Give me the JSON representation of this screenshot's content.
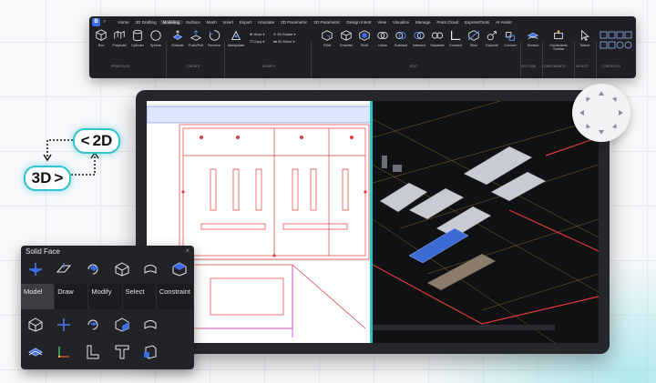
{
  "ribbon": {
    "menu": [
      "Home",
      "2D Drafting",
      "Modeling",
      "Surface",
      "Mesh",
      "Insert",
      "Export",
      "Annotate",
      "2D Parametric",
      "3D Parametric",
      "Design Intent",
      "View",
      "Visualize",
      "Manage",
      "Point Cloud",
      "ExpressTools",
      "AI Assist"
    ],
    "active_menu": "Modeling",
    "tools": {
      "box": "Box",
      "polysolid": "Polysolid",
      "cylinder": "Cylinder",
      "sphere": "Sphere",
      "extrude": "Extrude",
      "pushpull": "Push/Pull",
      "revolve": "Revolve",
      "manipulate": "Manipulate",
      "move": "Move",
      "copy": "Copy",
      "rotate3d": "3D Rotate",
      "mirror3d": "3D Mirror",
      "fillet": "Fillet",
      "chamfer": "Chamfer",
      "shell": "Shell",
      "union": "Union",
      "subtract": "Subtract",
      "intersect": "Intersect",
      "separate": "Separate",
      "connect": "Connect",
      "slice": "Slice",
      "explode": "Explode",
      "convert": "Convert",
      "section": "Section",
      "constraints_toolbar": "Constraints Toolbar",
      "select": "Select"
    },
    "groups": {
      "primitives": "PRIMITIVES",
      "create": "CREATE",
      "modify": "MODIFY",
      "edit": "EDIT",
      "section": "SECTION",
      "constraints": "CONSTRAINTS",
      "select": "SELECT",
      "controls": "CONTROLS"
    }
  },
  "toggle": {
    "to2d": "2D",
    "to3d": "3D"
  },
  "panel": {
    "title": "Solid Face",
    "tabs": [
      "Model",
      "Draw",
      "Modify",
      "Select",
      "Constraint"
    ],
    "active_tab": "Model"
  },
  "colors": {
    "accent": "#33c3cf",
    "ribbon_bg": "#1f2023",
    "brand": "#3b6ce8"
  }
}
